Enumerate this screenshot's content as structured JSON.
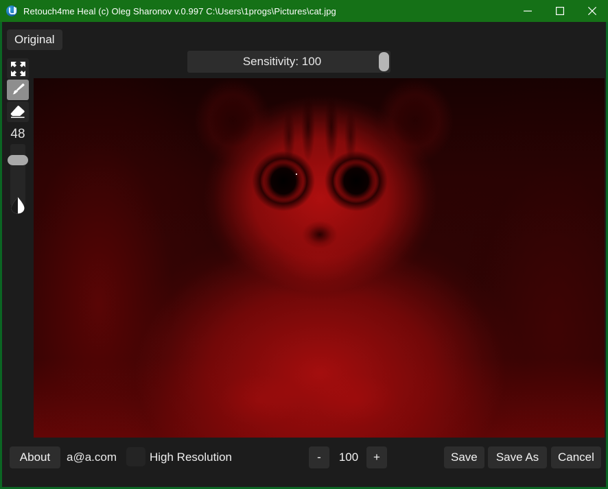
{
  "window": {
    "title": "Retouch4me Heal (c) Oleg Sharonov v.0.997 C:\\Users\\1progs\\Pictures\\cat.jpg",
    "app_icon": "retouch4me-logo-icon",
    "accent_color": "#157117",
    "background_color": "#1c1c1c",
    "controls": {
      "minimize": "minimize-icon",
      "maximize": "maximize-icon",
      "close": "close-icon"
    }
  },
  "toolbar": {
    "original_label": "Original",
    "sensitivity": {
      "label": "Sensitivity: 100",
      "value": 100,
      "min": 0,
      "max": 100
    }
  },
  "tools": {
    "fit_icon": "fullscreen-expand-icon",
    "brush_icon": "brush-icon",
    "brush_selected": true,
    "eraser_icon": "eraser-icon",
    "brush_size": "48",
    "contrast_icon": "contrast-droplet-icon"
  },
  "canvas": {
    "overlay_tint": "#b01010",
    "image_name": "cat.jpg"
  },
  "bottom": {
    "about_label": "About",
    "account_email": "a@a.com",
    "high_resolution_label": "High Resolution",
    "high_resolution_checked": false,
    "zoom_out_label": "-",
    "zoom_value": "100",
    "zoom_in_label": "+",
    "save_label": "Save",
    "save_as_label": "Save As",
    "cancel_label": "Cancel"
  }
}
